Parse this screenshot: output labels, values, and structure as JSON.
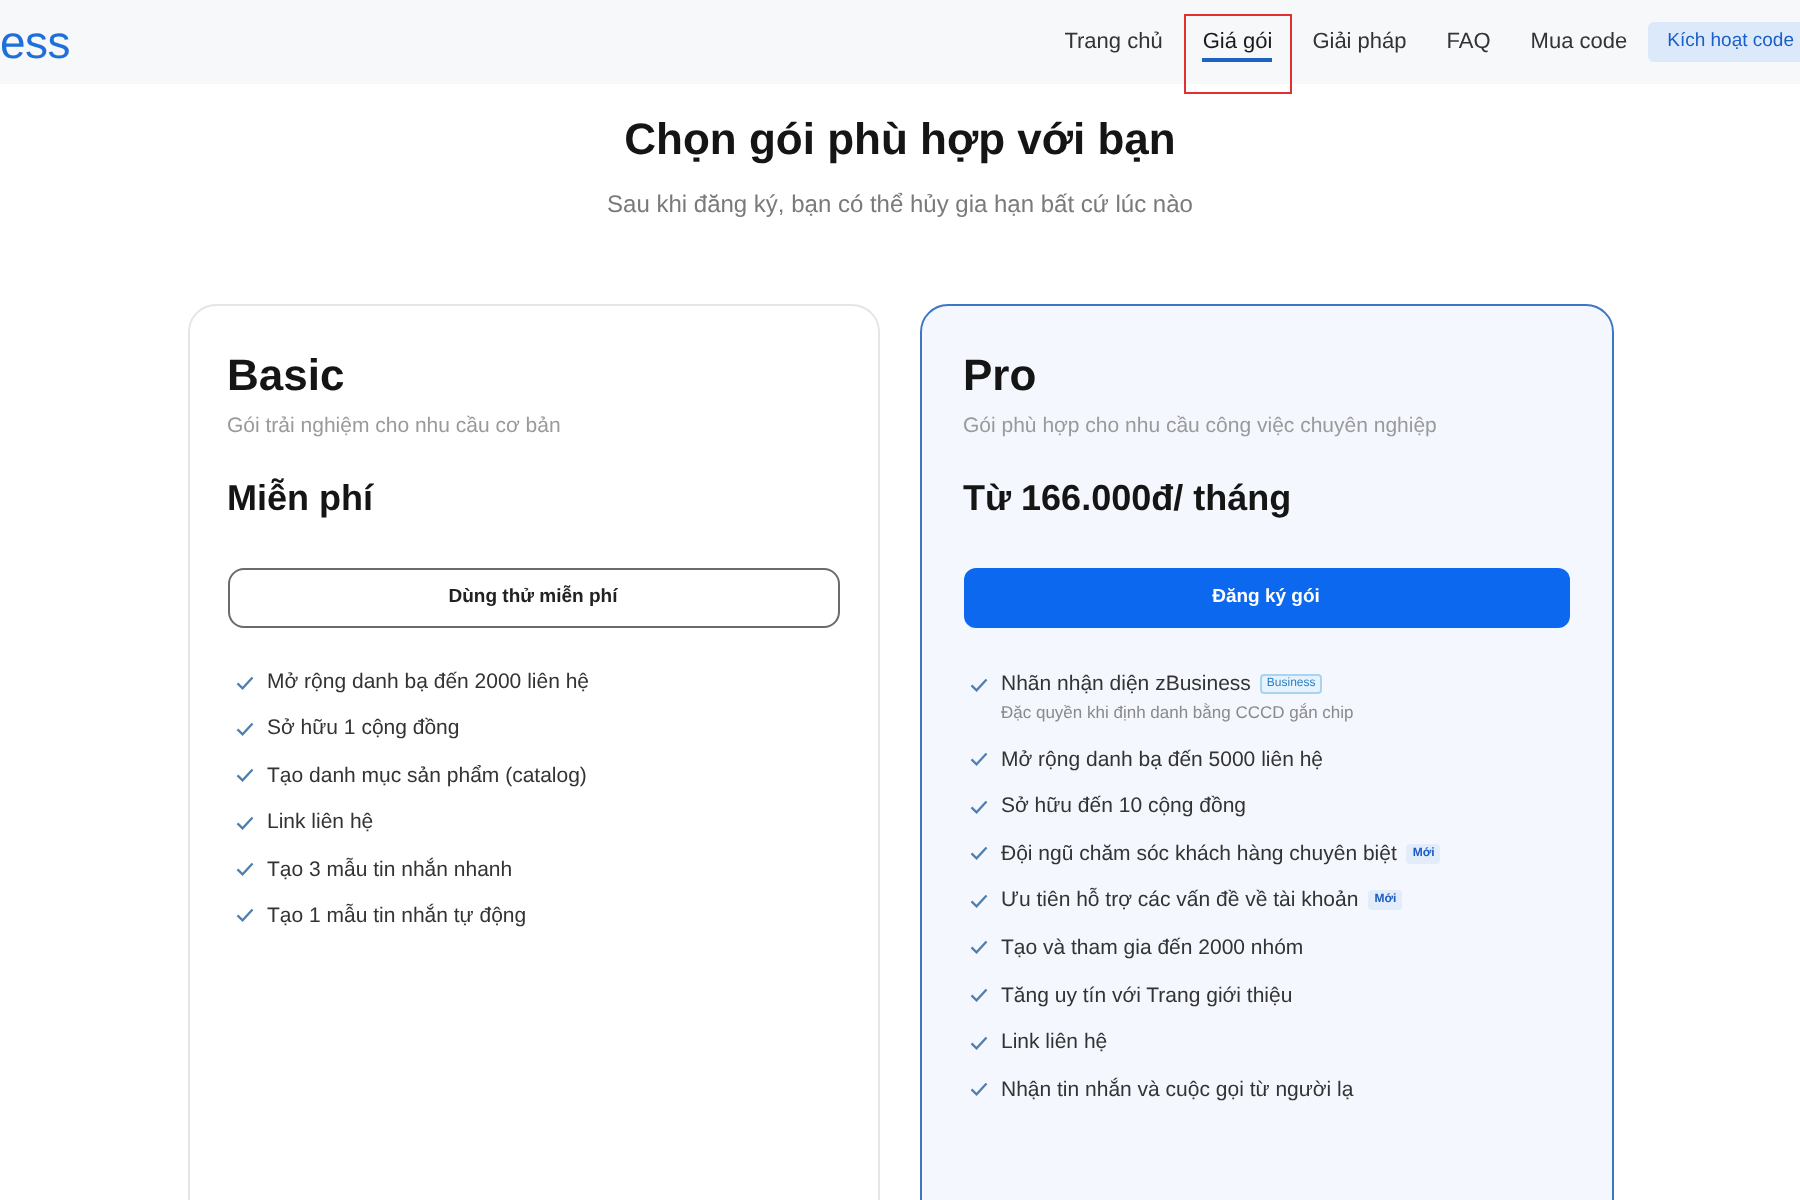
{
  "nav": {
    "logo": "ess",
    "items": [
      {
        "label": "Trang chủ",
        "selected": false,
        "highlighted": false
      },
      {
        "label": "Giá gói",
        "selected": true,
        "highlighted": true
      },
      {
        "label": "Giải pháp",
        "selected": false,
        "highlighted": false
      },
      {
        "label": "FAQ",
        "selected": false,
        "highlighted": false
      },
      {
        "label": "Mua code",
        "selected": false,
        "highlighted": false
      }
    ],
    "cta": "Kích hoạt code"
  },
  "header": {
    "title": "Chọn gói phù hợp với bạn",
    "subtitle": "Sau khi đăng ký, bạn có thể hủy gia hạn bất cứ lúc nào"
  },
  "plans": [
    {
      "name": "Basic",
      "description": "Gói trải nghiệm cho nhu cầu cơ bản",
      "price": "Miễn phí",
      "featured": false,
      "button": "Dùng thử miễn phí",
      "features": [
        {
          "text": "Mở rộng danh bạ đến 2000 liên hệ"
        },
        {
          "text": "Sở hữu 1 cộng đồng"
        },
        {
          "text": "Tạo danh mục sản phẩm (catalog)"
        },
        {
          "text": "Link liên hệ"
        },
        {
          "text": "Tạo 3 mẫu tin nhắn nhanh"
        },
        {
          "text": "Tạo 1 mẫu tin nhắn tự động"
        }
      ]
    },
    {
      "name": "Pro",
      "description": "Gói phù hợp cho nhu cầu công việc chuyên nghiệp",
      "price": "Từ 166.000đ/ tháng",
      "featured": true,
      "button": "Đăng ký gói",
      "features": [
        {
          "text": "Nhãn nhận diện zBusiness",
          "badge": {
            "text": "Business",
            "kind": "outline"
          },
          "note": "Đặc quyền khi định danh bằng CCCD gắn chip"
        },
        {
          "text": "Mở rộng danh bạ đến 5000 liên hệ"
        },
        {
          "text": "Sở hữu đến 10 cộng đồng"
        },
        {
          "text": "Đội ngũ chăm sóc khách hàng chuyên biệt",
          "badge": {
            "text": "Mới",
            "kind": "filled"
          }
        },
        {
          "text": "Ưu tiên hỗ trợ các vấn đề về tài khoản",
          "badge": {
            "text": "Mới",
            "kind": "filled"
          }
        },
        {
          "text": "Tạo và tham gia đến 2000 nhóm"
        },
        {
          "text": "Tăng uy tín với Trang giới thiệu"
        },
        {
          "text": "Link liên hệ"
        },
        {
          "text": "Nhận tin nhắn và cuộc gọi từ người lạ"
        }
      ]
    }
  ]
}
